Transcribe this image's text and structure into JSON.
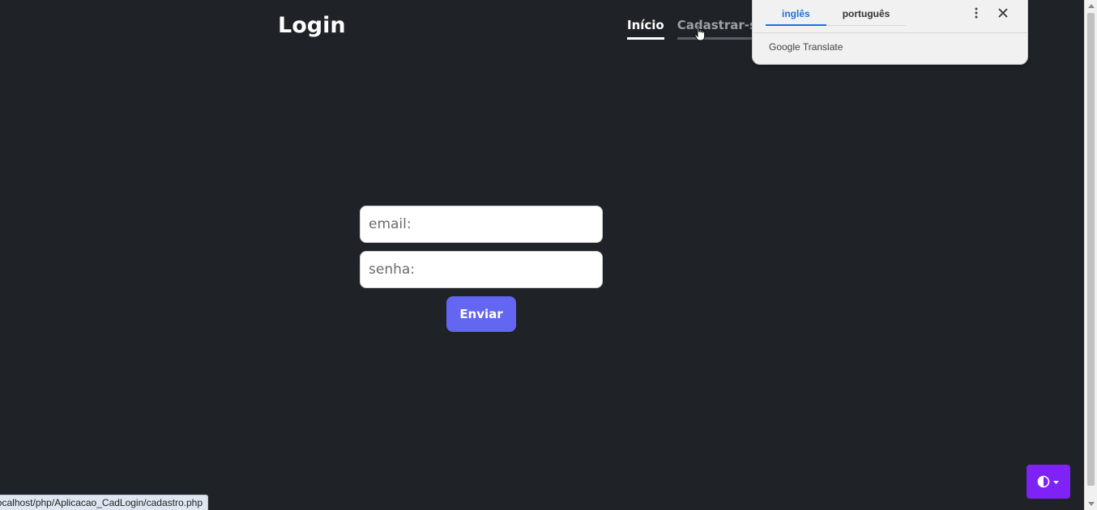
{
  "header": {
    "title": "Login",
    "nav": [
      {
        "label": "Início",
        "active": true
      },
      {
        "label": "Cadastrar-se",
        "active": false
      }
    ]
  },
  "form": {
    "email_placeholder": "email:",
    "password_placeholder": "senha:",
    "submit_label": "Enviar"
  },
  "translate_popup": {
    "tabs": [
      "inglês",
      "português"
    ],
    "active_tab": "inglês",
    "brand": "Google Translate",
    "icons": [
      "more-vert-icon",
      "close-icon"
    ]
  },
  "status_bar": {
    "url": "localhost/php/Aplicacao_CadLogin/cadastro.php"
  },
  "theme_toggle": {
    "icons": [
      "contrast-icon",
      "caret-down-icon"
    ]
  },
  "colors": {
    "background": "#1f2226",
    "button": "#6366f1",
    "toggle": "#7e22f5",
    "translate_accent": "#1a73e8"
  }
}
